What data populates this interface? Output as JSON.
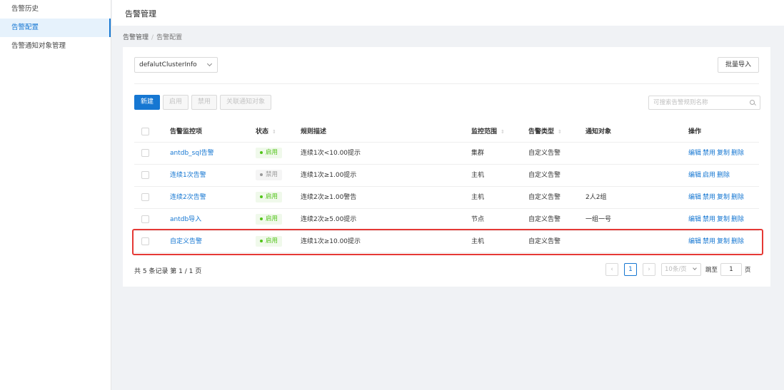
{
  "sidebar": {
    "items": [
      {
        "label": "告警历史",
        "active": false
      },
      {
        "label": "告警配置",
        "active": true
      },
      {
        "label": "告警通知对象管理",
        "active": false
      }
    ]
  },
  "header": {
    "title": "告警管理"
  },
  "breadcrumb": {
    "root": "告警管理",
    "separator": "/",
    "current": "告警配置"
  },
  "filter": {
    "cluster": "defalutClusterInfo"
  },
  "toolbar": {
    "import_label": "批量导入",
    "new_label": "新建",
    "enable_label": "启用",
    "disable_label": "禁用",
    "link_label": "关联通知对象",
    "search_placeholder": "可搜索告警规则名称"
  },
  "table": {
    "headers": {
      "name": "告警监控项",
      "status": "状态",
      "desc": "规则描述",
      "scope": "监控范围",
      "type": "告警类型",
      "notify": "通知对象",
      "ops": "操作"
    },
    "sort_icon": "⇕",
    "rows": [
      {
        "name": "antdb_sql告警",
        "status": "启用",
        "status_on": true,
        "desc": "连续1次<10.00提示",
        "scope": "集群",
        "type": "自定义告警",
        "notify": "",
        "ops": [
          "编辑",
          "禁用",
          "复制",
          "删除"
        ]
      },
      {
        "name": "连续1次告警",
        "status": "禁用",
        "status_on": false,
        "desc": "连续1次≥1.00提示",
        "scope": "主机",
        "type": "自定义告警",
        "notify": "",
        "ops": [
          "编辑",
          "启用",
          "删除"
        ]
      },
      {
        "name": "连续2次告警",
        "status": "启用",
        "status_on": true,
        "desc": "连续2次≥1.00警告",
        "scope": "主机",
        "type": "自定义告警",
        "notify": "2人2组",
        "ops": [
          "编辑",
          "禁用",
          "复制",
          "删除"
        ]
      },
      {
        "name": "antdb导入",
        "status": "启用",
        "status_on": true,
        "desc": "连续2次≥5.00提示",
        "scope": "节点",
        "type": "自定义告警",
        "notify": "一组一号",
        "ops": [
          "编辑",
          "禁用",
          "复制",
          "删除"
        ]
      },
      {
        "name": "自定义告警",
        "status": "启用",
        "status_on": true,
        "desc": "连续1次≥10.00提示",
        "scope": "主机",
        "type": "自定义告警",
        "notify": "",
        "ops": [
          "编辑",
          "禁用",
          "复制",
          "删除"
        ]
      }
    ]
  },
  "pagination": {
    "total_text": "共 5 条记录 第 1 / 1 页",
    "prev": "‹",
    "current": "1",
    "next": "›",
    "page_size": "10条/页",
    "jump_label": "跳至",
    "jump_value": "1",
    "page_unit": "页"
  },
  "colors": {
    "accent": "#1677d2",
    "enabled": "#52c41a",
    "highlight": "#e53935"
  }
}
